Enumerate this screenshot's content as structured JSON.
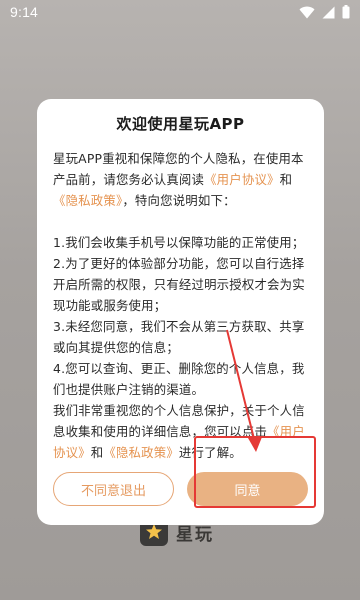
{
  "status_bar": {
    "time": "9:14",
    "icons": [
      "wifi-icon",
      "signal-icon",
      "battery-icon"
    ]
  },
  "dialog": {
    "title": "欢迎使用星玩APP",
    "intro_1": "星玩APP重视和保障您的个人隐私，在使用本产品前，请您务必认真阅读",
    "user_agreement_link": "《用户协议》",
    "and": "和",
    "privacy_policy_link": "《隐私政策》",
    "intro_2": "，特向您说明如下：",
    "items": [
      "1.我们会收集手机号以保障功能的正常使用；",
      "2.为了更好的体验部分功能，您可以自行选择开启所需的权限，只有经过明示授权才会为实现功能或服务使用；",
      "3.未经您同意，我们不会从第三方获取、共享或向其提供您的信息；",
      "4.您可以查询、更正、删除您的个人信息，我们也提供账户注销的渠道。"
    ],
    "outro_1": "我们非常重视您的个人信息保护，关于个人信息收集和使用的详细信息，您可以点击",
    "outro_link_1": "《用户协议》",
    "outro_and": "和",
    "outro_link_2": "《隐私政策》",
    "outro_2": "进行了解。",
    "decline_label": "不同意退出",
    "agree_label": "同意"
  },
  "brand": {
    "name": "星玩",
    "logo_icon": "star-logo-icon"
  },
  "colors": {
    "accent": "#e59350",
    "agree_button": "#e9b283",
    "highlight": "#e53935"
  }
}
